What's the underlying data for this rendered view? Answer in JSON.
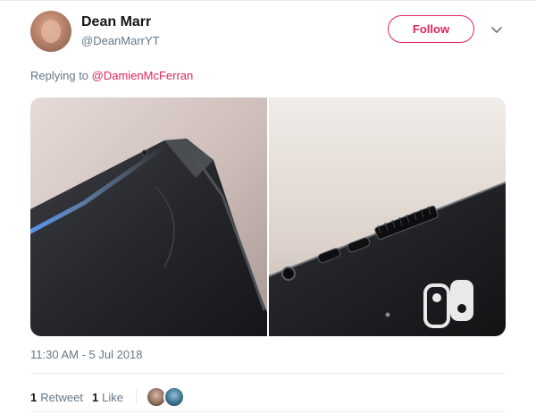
{
  "tweet": {
    "author": {
      "display_name": "Dean Marr",
      "handle": "@DeanMarrYT",
      "avatar_icon": "user-avatar"
    },
    "follow_label": "Follow",
    "menu_icon": "chevron-down-icon",
    "reply": {
      "prefix": "Replying to ",
      "mention": "@DamienMcFerran"
    },
    "media": [
      {
        "icon": "photo-console-corner"
      },
      {
        "icon": "photo-console-vents"
      }
    ],
    "timestamp": "11:30 AM - 5 Jul 2018",
    "stats": {
      "retweets_count": "1",
      "retweets_label": "Retweet",
      "likes_count": "1",
      "likes_label": "Like"
    },
    "likers": [
      {
        "icon": "liker-avatar"
      },
      {
        "icon": "liker-avatar"
      }
    ]
  },
  "colors": {
    "accent": "#e0245e",
    "muted_text": "#657786",
    "primary_text": "#14171a",
    "divider": "#e6ecf0"
  }
}
